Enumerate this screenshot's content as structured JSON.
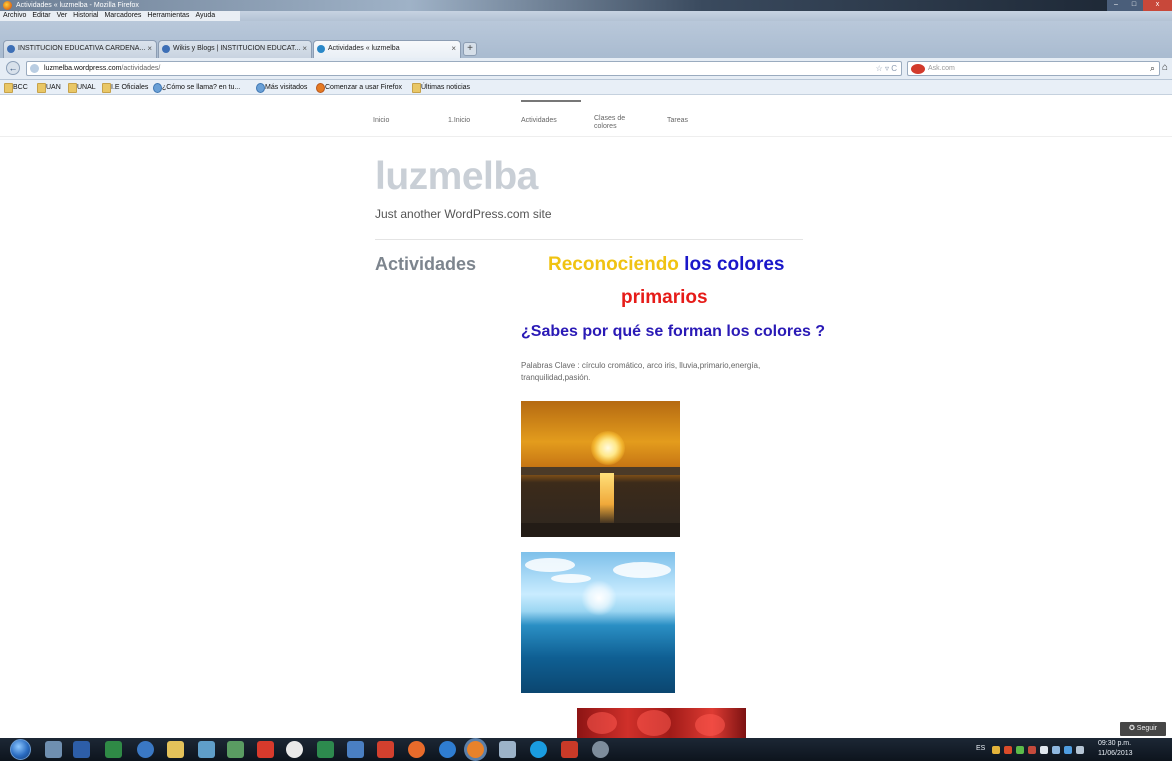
{
  "window": {
    "title": "Actividades « luzmelba - Mozilla Firefox",
    "controls": {
      "minimize": "–",
      "maximize": "□",
      "close": "x"
    }
  },
  "menubar": [
    "Archivo",
    "Editar",
    "Ver",
    "Historial",
    "Marcadores",
    "Herramientas",
    "Ayuda"
  ],
  "tabs": [
    {
      "label": "INSTITUCION EDUCATIVA CARDENA...",
      "close": "×"
    },
    {
      "label": "Wikis y Blogs | INSTITUCION EDUCAT...",
      "close": "×"
    },
    {
      "label": "Actividades « luzmelba",
      "close": "×"
    }
  ],
  "newtab_label": "+",
  "navbar": {
    "back": "←",
    "url_host": "luzmelba.wordpress.com",
    "url_path": "/actividades/",
    "url_controls": "☆ ▿ C",
    "search_engine": "Ask.com",
    "search_icon": "⌕",
    "home_icon": "⌂"
  },
  "bookmarks": [
    "BCC",
    "UAN",
    "UNAL",
    "I.E Oficiales",
    "¿Cómo se llama? en tu...",
    "Más visitados",
    "Comenzar a usar Firefox",
    "Últimas noticias"
  ],
  "site_nav": [
    "Inicio",
    "1.Inicio",
    "Actividades",
    "Clases de colores",
    "Tareas"
  ],
  "site": {
    "title": "luzmelba",
    "tagline": "Just another WordPress.com site",
    "page_title": "Actividades"
  },
  "content": {
    "heading_part1": "Reconociendo",
    "heading_part2": " los colores",
    "heading_line2": "primarios",
    "question": "¿Sabes por qué se forman los colores ?",
    "keywords": "Palabras Clave : círculo cromático, arco iris, lluvia,primario,energía, tranquilidad,pasión."
  },
  "follow_button": "✪ Seguir",
  "taskbar": {
    "lang": "ES",
    "time": "09:30 p.m.",
    "date": "11/06/2013"
  },
  "colors": {
    "yellow": "#f0c312",
    "blue": "#1a17c9",
    "red": "#e61c19",
    "question": "#2a1ab6"
  }
}
